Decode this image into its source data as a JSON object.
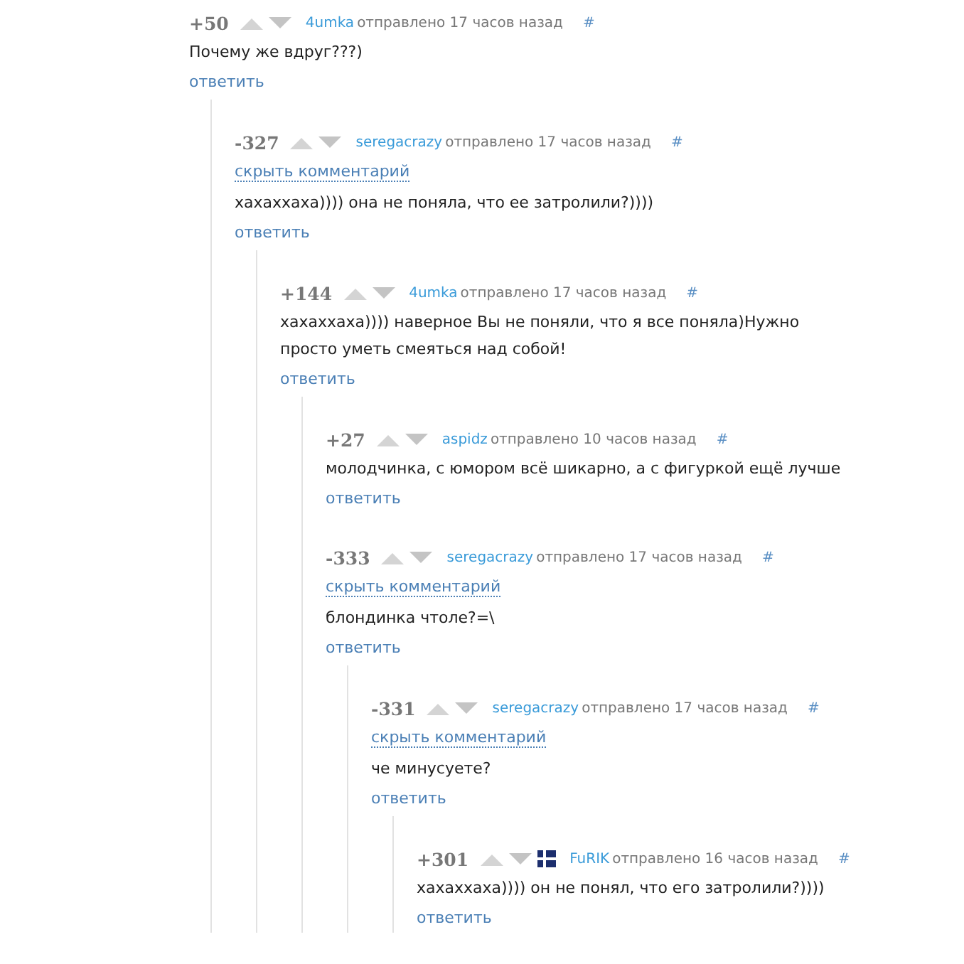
{
  "comments": [
    {
      "score": "+50",
      "author": "4umka",
      "flag": false,
      "time": "отправлено 17 часов назад",
      "hash": "#",
      "text": "Почему же вдруг???)",
      "reply": "ответить",
      "children": [
        {
          "score": "-327",
          "author": "seregacrazy",
          "flag": false,
          "time": "отправлено 17 часов назад",
          "hash": "#",
          "hide": "скрыть комментарий",
          "text": "хахаххаха)))) она не поняла, что ее затролили?))))",
          "reply": "ответить",
          "children": [
            {
              "score": "+144",
              "author": "4umka",
              "flag": false,
              "time": "отправлено 17 часов назад",
              "hash": "#",
              "text": "хахаххаха)))) наверное Вы не поняли, что я все поняла)Нужно просто уметь смеяться над собой!",
              "reply": "ответить",
              "children": [
                {
                  "score": "+27",
                  "author": "aspidz",
                  "flag": false,
                  "time": "отправлено 10 часов назад",
                  "hash": "#",
                  "text": "молодчинка, с юмором всё шикарно, а с фигуркой ещё лучше",
                  "reply": "ответить"
                },
                {
                  "score": "-333",
                  "author": "seregacrazy",
                  "flag": false,
                  "time": "отправлено 17 часов назад",
                  "hash": "#",
                  "hide": "скрыть комментарий",
                  "text": "блондинка чтоле?=\\",
                  "reply": "ответить",
                  "children": [
                    {
                      "score": "-331",
                      "author": "seregacrazy",
                      "flag": false,
                      "time": "отправлено 17 часов назад",
                      "hash": "#",
                      "hide": "скрыть комментарий",
                      "text": "че минусуете?",
                      "reply": "ответить",
                      "children": [
                        {
                          "score": "+301",
                          "author": "FuRIK",
                          "flag": true,
                          "time": "отправлено 16 часов назад",
                          "hash": "#",
                          "text": "хахаххаха)))) он не понял, что его затролили?))))",
                          "reply": "ответить"
                        }
                      ]
                    }
                  ]
                }
              ]
            }
          ]
        }
      ]
    }
  ]
}
